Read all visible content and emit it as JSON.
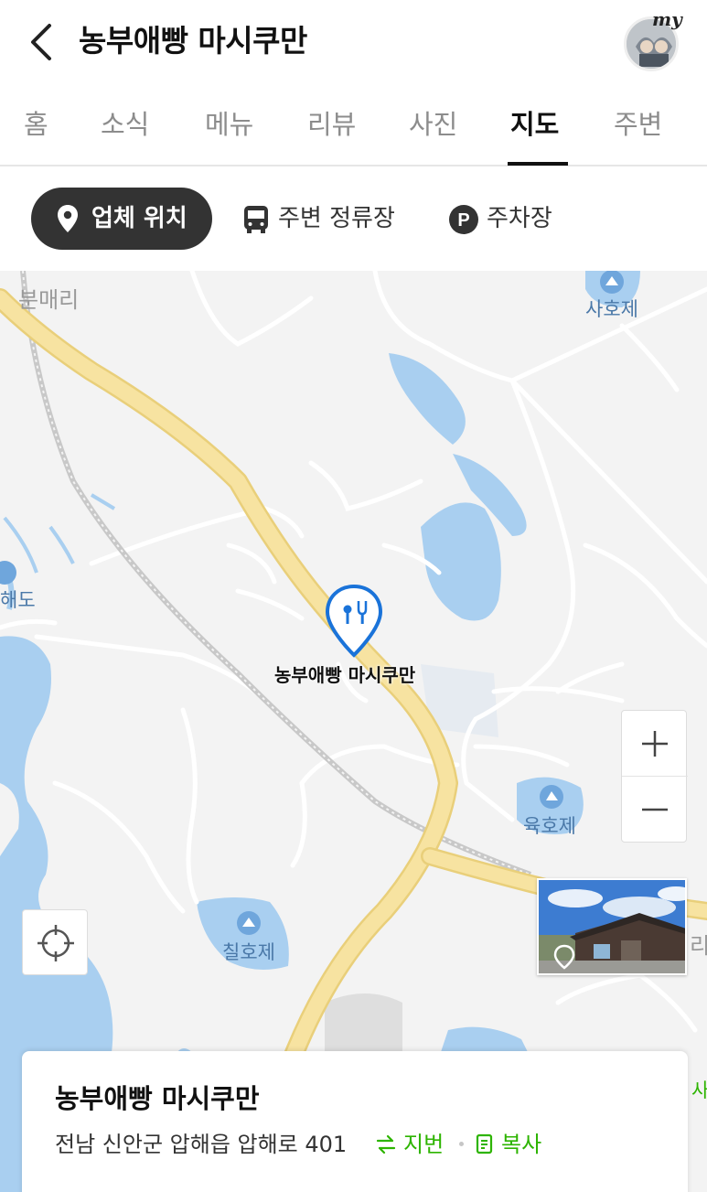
{
  "header": {
    "title": "농부애빵 마시쿠만",
    "avatar_badge": "my"
  },
  "tabs": [
    {
      "label": "홈",
      "active": false
    },
    {
      "label": "소식",
      "active": false
    },
    {
      "label": "메뉴",
      "active": false
    },
    {
      "label": "리뷰",
      "active": false
    },
    {
      "label": "사진",
      "active": false
    },
    {
      "label": "지도",
      "active": true
    },
    {
      "label": "주변",
      "active": false
    }
  ],
  "filters": {
    "business_location": "업체 위치",
    "nearby_stops": "주변 정류장",
    "parking": "주차장",
    "parking_icon_letter": "P"
  },
  "map": {
    "place_labels": {
      "bunmae_ri": "분매리",
      "saho_je": "사호제",
      "hae_do": "해도",
      "yukho_je": "육호제",
      "chilho_je": "칠호제",
      "edge_ri": "리",
      "edge_sa": "사"
    },
    "pin_label": "농부애빵 마시쿠만",
    "zoom_in": "+",
    "zoom_out": "−",
    "colors": {
      "road_main": "#f7e3a1",
      "road_main_edge": "#e9cf7a",
      "water": "#a9cff0",
      "land": "#f3f3f3",
      "pin": "#1a73d9"
    }
  },
  "place_card": {
    "name": "농부애빵 마시쿠만",
    "address": "전남 신안군 압해읍 압해로 401",
    "jibun_label": "지번",
    "copy_label": "복사",
    "accent_color": "#2db400"
  }
}
